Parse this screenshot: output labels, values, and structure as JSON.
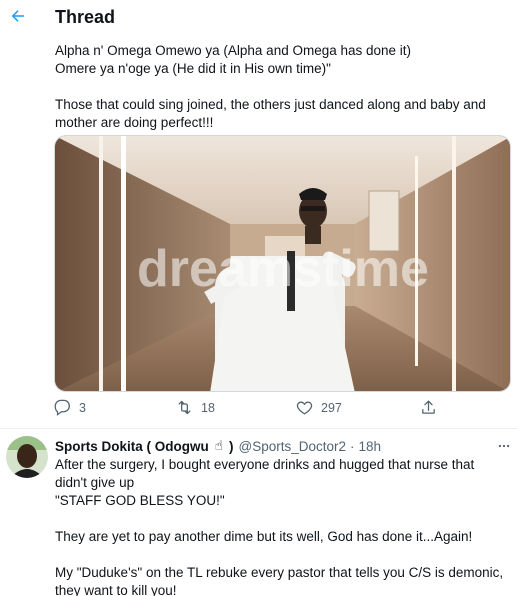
{
  "header": {
    "title": "Thread",
    "accent": "#1d9bf0"
  },
  "tweet1": {
    "lines": [
      "Alpha n' Omega Omewo ya (Alpha and Omega has done it)",
      "Omere ya n'oge ya (He did it in His own time)\"",
      "",
      "Those that could sing joined, the others just danced along and baby and",
      "mother are doing perfect!!!"
    ],
    "media": {
      "watermark": "dreamstime"
    },
    "actions": {
      "replies": "3",
      "retweets": "18",
      "likes": "297"
    }
  },
  "tweet2": {
    "author_name": "Sports Dokita ( Odogwu",
    "emoji": "☝",
    "author_name_end": ")",
    "handle": "@Sports_Doctor2",
    "separator": "·",
    "time": "18h",
    "lines": [
      "After the surgery, I bought everyone drinks and hugged that nurse that",
      "didn't give up",
      "\"STAFF GOD BLESS YOU!\"",
      "",
      "They are yet to pay another dime but its well, God has done it...Again!",
      "",
      "My \"Duduke's\" on the TL rebuke every pastor that tells you C/S is demonic,",
      "they want to kill you!"
    ]
  }
}
